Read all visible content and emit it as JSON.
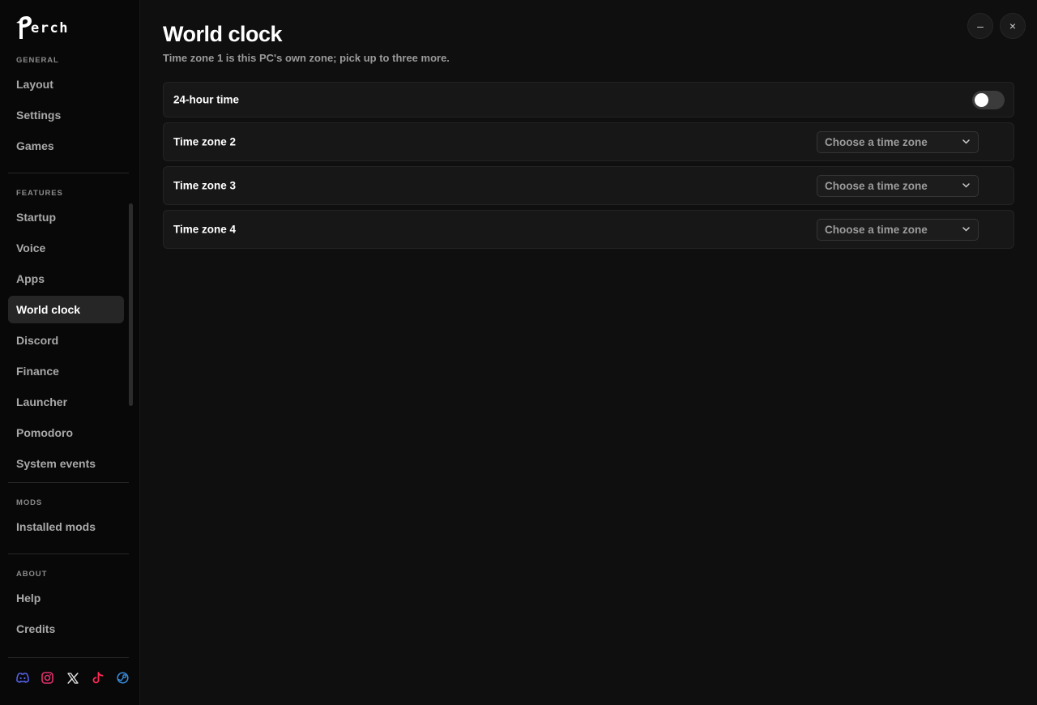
{
  "app": {
    "logo_text": "erch"
  },
  "sidebar": {
    "sections": [
      {
        "label": "GENERAL"
      },
      {
        "label": "FEATURES"
      },
      {
        "label": "MODS"
      },
      {
        "label": "ABOUT"
      }
    ],
    "items": [
      {
        "label": "Layout"
      },
      {
        "label": "Settings"
      },
      {
        "label": "Games"
      },
      {
        "label": "Startup"
      },
      {
        "label": "Voice"
      },
      {
        "label": "Apps"
      },
      {
        "label": "World clock"
      },
      {
        "label": "Discord"
      },
      {
        "label": "Finance"
      },
      {
        "label": "Launcher"
      },
      {
        "label": "Pomodoro"
      },
      {
        "label": "System events"
      },
      {
        "label": "Installed mods"
      },
      {
        "label": "Help"
      },
      {
        "label": "Credits"
      }
    ],
    "active": "World clock",
    "socials": [
      {
        "icon": "discord-icon",
        "color": "#5865f2"
      },
      {
        "icon": "instagram-icon",
        "color": "#e1306c"
      },
      {
        "icon": "x-icon",
        "color": "#e6e6e6"
      },
      {
        "icon": "tiktok-icon",
        "color": "#ff2a55"
      },
      {
        "icon": "steam-icon",
        "color": "#3a8fe0"
      }
    ]
  },
  "window": {
    "minimize": "–",
    "close": "×"
  },
  "main": {
    "title": "World clock",
    "subtitle": "Time zone 1 is this PC's own zone; pick up to three more.",
    "toggle_row": {
      "label": "24-hour time",
      "checked": false
    },
    "zones": [
      {
        "label": "Time zone 2",
        "placeholder": "Choose a time zone"
      },
      {
        "label": "Time zone 3",
        "placeholder": "Choose a time zone"
      },
      {
        "label": "Time zone 4",
        "placeholder": "Choose a time zone"
      }
    ]
  }
}
